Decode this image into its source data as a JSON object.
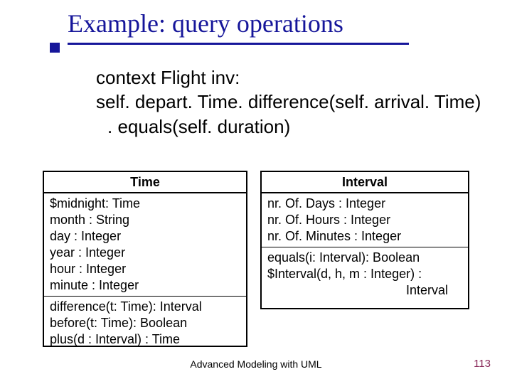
{
  "title": "Example: query operations",
  "body": {
    "line1": "context Flight inv:",
    "line2": "self. depart. Time. difference(self. arrival. Time)",
    "line3": ". equals(self. duration)"
  },
  "uml": {
    "time": {
      "name": "Time",
      "attrs": [
        "$midnight: Time",
        "month : String",
        "day : Integer",
        "year : Integer",
        "hour : Integer",
        "minute : Integer"
      ],
      "ops": [
        "difference(t: Time): Interval",
        "before(t: Time): Boolean",
        "plus(d : Interval) : Time"
      ]
    },
    "interval": {
      "name": "Interval",
      "attrs": [
        "nr. Of. Days : Integer",
        "nr. Of. Hours : Integer",
        "nr. Of. Minutes : Integer"
      ],
      "ops": [
        "equals(i: Interval): Boolean",
        "$Interval(d, h, m : Integer) :"
      ],
      "ops_return": "Interval"
    }
  },
  "footer": {
    "center": "Advanced Modeling with UML",
    "page": "113"
  }
}
